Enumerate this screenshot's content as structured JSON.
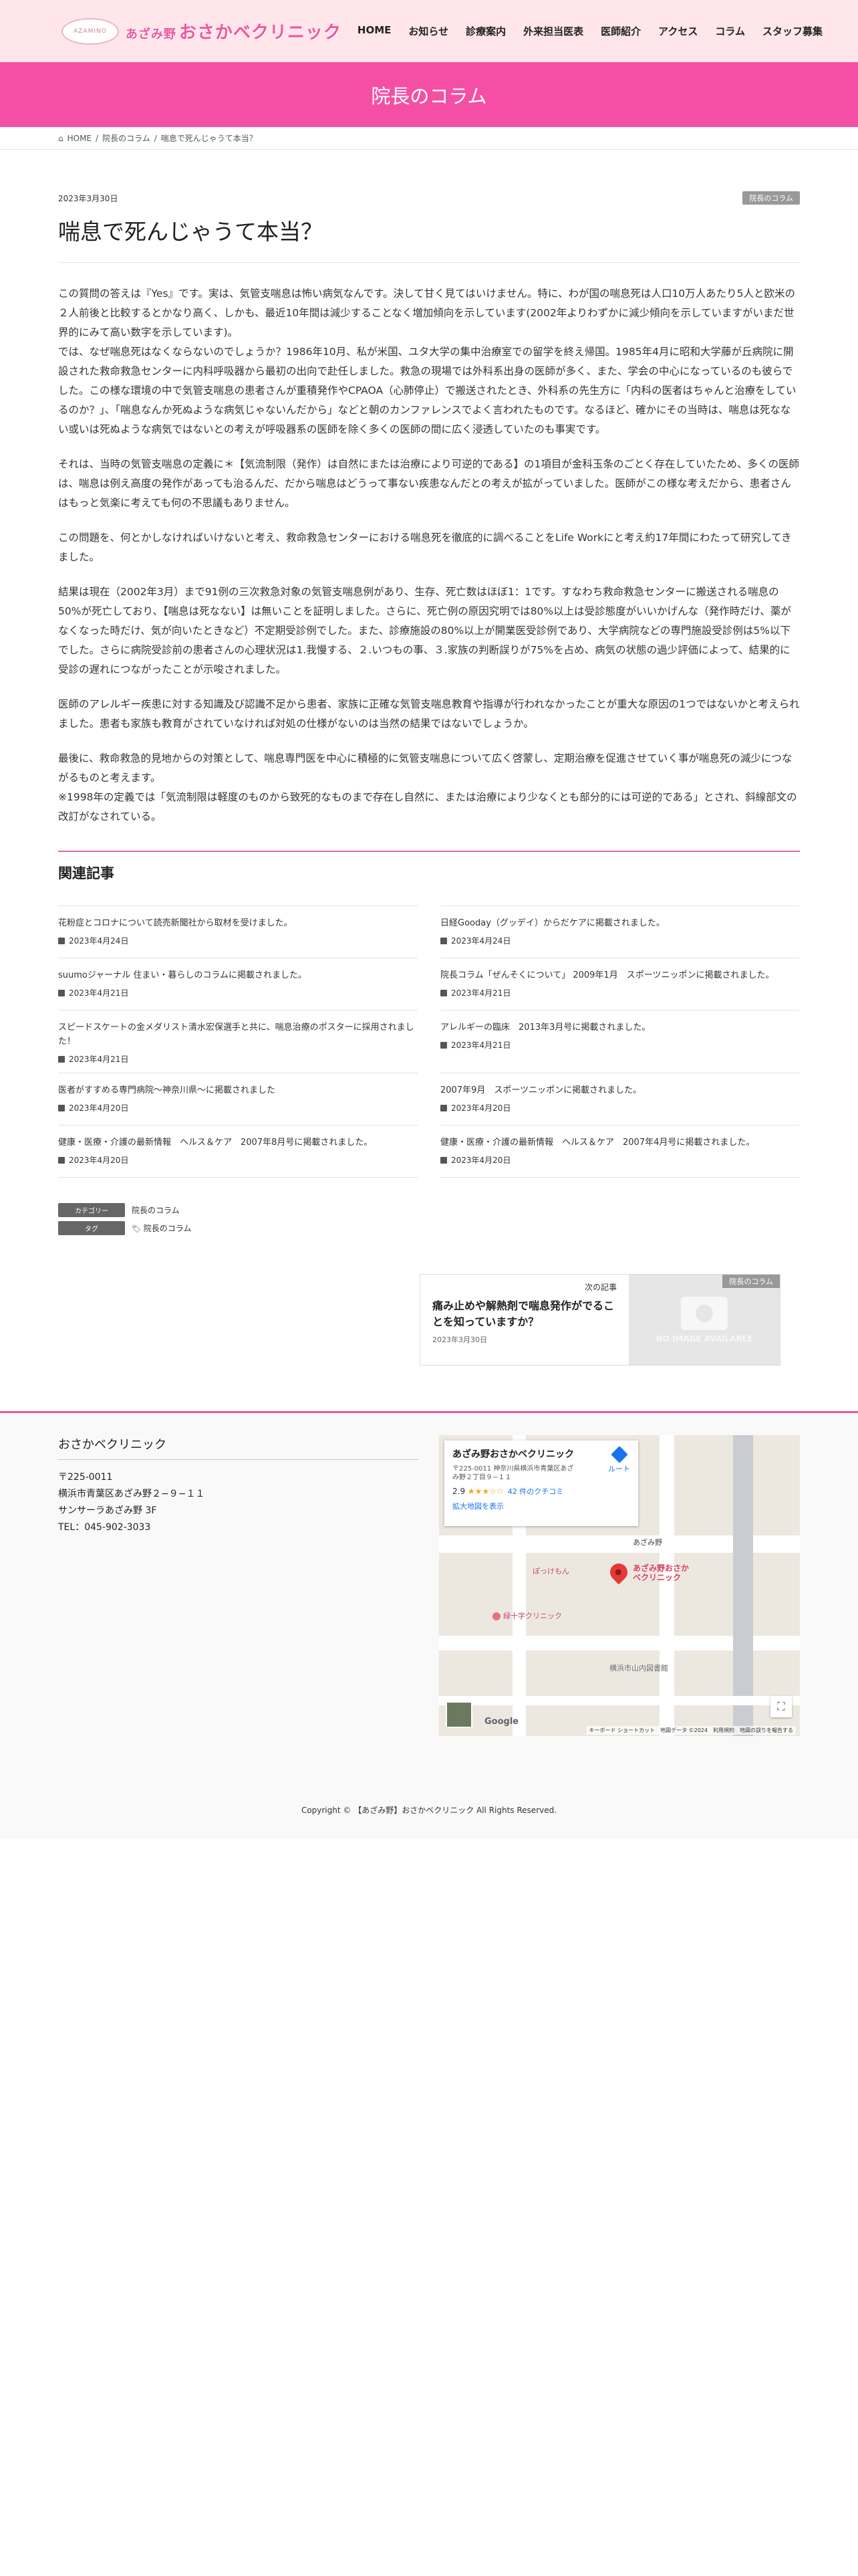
{
  "header": {
    "logo_mark": "AZAMINO",
    "logo_small": "あざみ野",
    "logo_text": "おさかベクリニック",
    "nav": [
      "HOME",
      "お知らせ",
      "診療案内",
      "外来担当医表",
      "医師紹介",
      "アクセス",
      "コラム",
      "スタッフ募集"
    ]
  },
  "band": {
    "title": "院長のコラム"
  },
  "breadcrumb": {
    "home": "HOME",
    "section": "院長のコラム",
    "current": "喘息で死んじゃうて本当？"
  },
  "post": {
    "date": "2023年3月30日",
    "category_badge": "院長のコラム",
    "title": "喘息で死んじゃうて本当？",
    "paragraphs": [
      "この質問の答えは『Yes』です。実は、気管支喘息は怖い病気なんです。決して甘く見てはいけません。特に、わが国の喘息死は人口10万人あたり5人と欧米の２人前後と比較するとかなり高く、しかも、最近10年間は減少することなく増加傾向を示しています(2002年よりわずかに減少傾向を示していますがいまだ世界的にみて高い数字を示しています)。\nでは、なぜ喘息死はなくならないのでしょうか？1986年10月、私が米国、ユタ大学の集中治療室での留学を終え帰国。1985年4月に昭和大学藤が丘病院に開設された救命救急センターに内科呼吸器から最初の出向で赴任しました。救急の現場では外科系出身の医師が多く、また、学会の中心になっているのも彼らでした。この様な環境の中で気管支喘息の患者さんが重積発作やCPAOA（心肺停止）で搬送されたとき、外科系の先生方に「内科の医者はちゃんと治療をしているのか？」、「喘息なんか死ぬような病気じゃないんだから」などと朝のカンファレンスでよく言われたものです。なるほど、確かにその当時は、喘息は死なない或いは死ぬような病気ではないとの考えが呼吸器系の医師を除く多くの医師の間に広く浸透していたのも事実です。",
      "それは、当時の気管支喘息の定義に＊【気流制限（発作）は自然にまたは治療により可逆的である】の1項目が金科玉条のごとく存在していたため、多くの医師は、喘息は例え高度の発作があっても治るんだ、だから喘息はどうって事ない疾患なんだとの考えが拡がっていました。医師がこの様な考えだから、患者さんはもっと気楽に考えても何の不思議もありません。",
      "この問題を、何とかしなければいけないと考え、救命救急センターにおける喘息死を徹底的に調べることをLife Workにと考え約17年間にわたって研究してきました。",
      "結果は現在（2002年3月）まで91例の三次救急対象の気管支喘息例があり、生存、死亡数はほぼ1：1です。すなわち救命救急センターに搬送される喘息の50%が死亡しており、【喘息は死なない】は無いことを証明しました。さらに、死亡例の原因究明では80%以上は受診態度がいいかげんな（発作時だけ、薬がなくなった時だけ、気が向いたときなど）不定期受診例でした。また、診療施設の80%以上が開業医受診例であり、大学病院などの専門施設受診例は5%以下でした。さらに病院受診前の患者さんの心理状況は1.我慢する、２.いつもの事、３.家族の判断誤りが75%を占め、病気の状態の過少評価によって、結果的に受診の遅れにつながったことが示唆されました。",
      "医師のアレルギー疾患に対する知識及び認識不足から患者、家族に正確な気管支喘息教育や指導が行われなかったことが重大な原因の1つではないかと考えられました。患者も家族も教育がされていなければ対処の仕様がないのは当然の結果ではないでしょうか。",
      "最後に、救命救急的見地からの対策として、喘息専門医を中心に積極的に気管支喘息について広く啓蒙し、定期治療を促進させていく事が喘息死の減少につながるものと考えます。\n※1998年の定義では「気流制限は軽度のものから致死的なものまで存在し自然に、または治療により少なくとも部分的には可逆的である」とされ、斜線部文の改訂がなされている。"
    ]
  },
  "related": {
    "heading": "関連記事",
    "items": [
      {
        "title": "花粉症とコロナについて読売新聞社から取材を受けました。",
        "date": "2023年4月24日"
      },
      {
        "title": "日経Gooday（グッデイ）からだケアに掲載されました。",
        "date": "2023年4月24日"
      },
      {
        "title": "suumoジャーナル 住まい・暮らしのコラムに掲載されました。",
        "date": "2023年4月21日"
      },
      {
        "title": "院長コラム「ぜんそくについて」 2009年1月　スポーツニッポンに掲載されました。",
        "date": "2023年4月21日"
      },
      {
        "title": "スピードスケートの金メダリスト清水宏保選手と共に、喘息治療のポスターに採用されました！",
        "date": "2023年4月21日"
      },
      {
        "title": "アレルギーの臨床　2013年3月号に掲載されました。",
        "date": "2023年4月21日"
      },
      {
        "title": "医者がすすめる専門病院～神奈川県～に掲載されました",
        "date": "2023年4月20日"
      },
      {
        "title": "2007年9月　スポーツニッポンに掲載されました。",
        "date": "2023年4月20日"
      },
      {
        "title": "健康・医療・介護の最新情報　ヘルス＆ケア　2007年8月号に掲載されました。",
        "date": "2023年4月20日"
      },
      {
        "title": "健康・医療・介護の最新情報　ヘルス＆ケア　2007年4月号に掲載されました。",
        "date": "2023年4月20日"
      }
    ]
  },
  "taxonomy": {
    "category_label": "カテゴリー",
    "category_value": "院長のコラム",
    "tag_label": "タグ",
    "tag_value": "院長のコラム"
  },
  "next_post": {
    "label": "次の記事",
    "title": "痛み止めや解熱剤で喘息発作がでることを知っていますか？",
    "date": "2023年3月30日",
    "badge": "院長のコラム",
    "noimage_text": "NO IMAGE AVAILABLE"
  },
  "footer": {
    "clinic_name": "おさかベクリニック",
    "address_lines": [
      "〒225-0011",
      "横浜市青葉区あざみ野２−９−１１",
      "サンサーラあざみ野 3F",
      "TEL：045-902-3033"
    ],
    "copyright": "Copyright © 【あざみ野】おさかベクリニック All Rights Reserved."
  },
  "map": {
    "place_name": "あざみ野おさかベクリニック",
    "place_address": "〒225-0011 神奈川県横浜市青葉区あざみ野２丁目９−１１",
    "rating": "2.9",
    "stars": "★★★☆☆",
    "reviews": "42 件のクチコミ",
    "enlarge_link": "拡大地図を表示",
    "route": "ルート",
    "pin_label": "あざみ野おさかべクリニック",
    "poi_1": "ぽっけもん",
    "poi_2": "緑十字クリニック",
    "poi_3": "横浜市山内図書館",
    "poi_4": "あざみ野",
    "google": "Google",
    "terms": "キーボード ショートカット　地図データ ©2024　利用規約　地図の誤りを報告する",
    "fullscreen_icon": "⛶"
  },
  "colors": {
    "header_bg": "#ffe6ea",
    "accent": "#f54fa5",
    "logo": "#f056a0",
    "badge": "#999999"
  }
}
